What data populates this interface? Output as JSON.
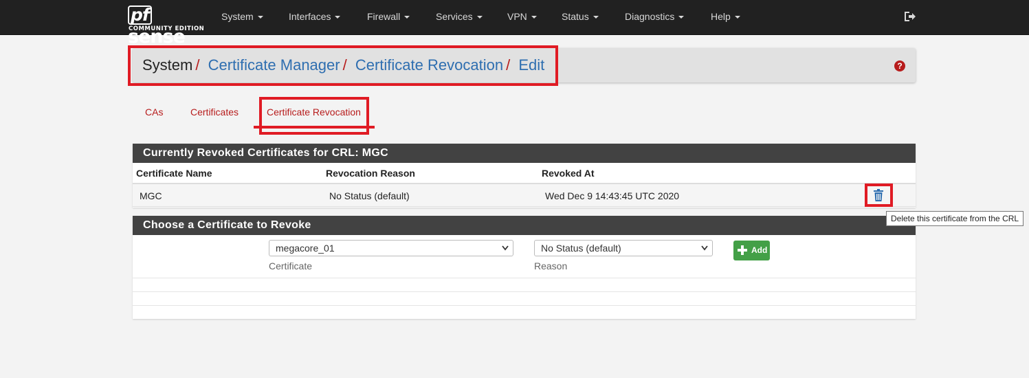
{
  "brand": {
    "logo_prefix": "pf",
    "logo_text": "sense",
    "subtitle": "COMMUNITY EDITION"
  },
  "nav": {
    "items": [
      {
        "label": "System"
      },
      {
        "label": "Interfaces"
      },
      {
        "label": "Firewall"
      },
      {
        "label": "Services"
      },
      {
        "label": "VPN"
      },
      {
        "label": "Status"
      },
      {
        "label": "Diagnostics"
      },
      {
        "label": "Help"
      }
    ],
    "logout_icon": "logout-icon"
  },
  "breadcrumb": {
    "items": [
      "System",
      "Certificate Manager",
      "Certificate Revocation",
      "Edit"
    ],
    "separator": "/",
    "help_icon": "help-icon",
    "help_glyph": "?"
  },
  "tabs": {
    "items": [
      {
        "label": "CAs"
      },
      {
        "label": "Certificates"
      },
      {
        "label": "Certificate Revocation",
        "active": true
      }
    ]
  },
  "revoked_panel": {
    "title": "Currently Revoked Certificates for CRL: MGC",
    "columns": [
      "Certificate Name",
      "Revocation Reason",
      "Revoked At"
    ],
    "rows": [
      {
        "name": "MGC",
        "reason": "No Status (default)",
        "revoked_at": "Wed Dec 9 14:43:45 UTC 2020"
      }
    ],
    "delete_tooltip": "Delete this certificate from the CRL"
  },
  "revoke_panel": {
    "title": "Choose a Certificate to Revoke",
    "certificate_select": {
      "value": "megacore_01",
      "help": "Certificate"
    },
    "reason_select": {
      "value": "No Status (default)",
      "help": "Reason"
    },
    "add_label": "Add"
  },
  "colors": {
    "navbar": "#212121",
    "link": "#2e6eb0",
    "accent_red": "#b71c1c",
    "highlight": "#e01b24",
    "panel_heading": "#424242",
    "add_button": "#43a047"
  }
}
